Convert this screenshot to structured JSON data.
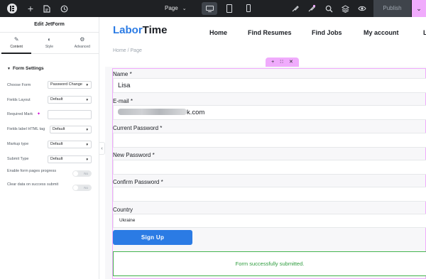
{
  "topbar": {
    "page_label": "Page",
    "publish_label": "Publish",
    "icons": [
      "elementor-logo-icon",
      "plus-icon",
      "structure-icon",
      "history-icon",
      "device-desktop-icon",
      "device-tablet-icon",
      "device-mobile-icon",
      "paint-icon",
      "notes-icon",
      "search-icon",
      "layers-icon",
      "preview-eye-icon",
      "chevron-down-icon"
    ]
  },
  "panel": {
    "title": "Edit JetForm",
    "tabs": [
      {
        "label": "Content",
        "icon": "pencil-icon",
        "active": true
      },
      {
        "label": "Style",
        "icon": "half-circle-icon",
        "active": false
      },
      {
        "label": "Advanced",
        "icon": "gear-icon",
        "active": false
      }
    ],
    "section_title": "Form Settings",
    "controls": {
      "choose_form": {
        "label": "Choose Form",
        "value": "Password Change"
      },
      "fields_layout": {
        "label": "Fields Layout",
        "value": "Default"
      },
      "required_mark": {
        "label": "Required Mark",
        "value": ""
      },
      "fields_label_tag": {
        "label": "Fields label HTML tag",
        "value": "Default"
      },
      "markup_type": {
        "label": "Markup type",
        "value": "Default"
      },
      "submit_type": {
        "label": "Submit Type",
        "value": "Default"
      },
      "enable_progress": {
        "label": "Enable form pages progress",
        "value": "No"
      },
      "clear_data": {
        "label": "Clear data on success submit",
        "value": "No"
      }
    }
  },
  "site": {
    "brand_part1": "Labor",
    "brand_part2": "Time",
    "nav": [
      "Home",
      "Find Resumes",
      "Find Jobs",
      "My account",
      "L"
    ],
    "breadcrumb": "Home / Page"
  },
  "form": {
    "name_label": "Name *",
    "name_value": "Lisa",
    "email_label": "E-mail *",
    "email_value_visible": "k.com",
    "current_password_label": "Current Password *",
    "new_password_label": "New Password *",
    "confirm_password_label": "Confirm Password *",
    "country_label": "Country",
    "country_value": "Ukraine",
    "submit_label": "Sign Up",
    "success_message": "Form successfully submitted."
  },
  "colors": {
    "accent": "#2b7be4",
    "editor_pink": "#f0abfc",
    "success_green": "#46b450",
    "topbar": "#1f2124"
  }
}
